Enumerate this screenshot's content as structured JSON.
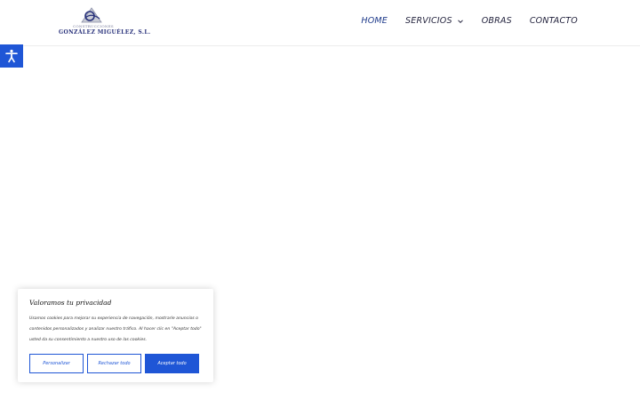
{
  "logo": {
    "small_text": "CONSTRUCCIONES",
    "main_text": "GONZÁLEZ MIGUÉLEZ, S.L."
  },
  "nav": {
    "home": "HOME",
    "servicios": "SERVICIOS",
    "obras": "OBRAS",
    "contacto": "CONTACTO"
  },
  "accessibility": {
    "icon": "accessibility-icon"
  },
  "cookie": {
    "title": "Valoramos tu privacidad",
    "text": "Usamos cookies para mejorar su experiencia de navegación, mostrarle anuncios o contenidos personalizados y analizar nuestro tráfico. Al hacer clic en \"Aceptar todo\" usted da su consentimiento a nuestro uso de las cookies.",
    "customize": "Personalizar",
    "reject": "Rechazar todo",
    "accept": "Aceptar todo"
  },
  "colors": {
    "accent": "#1f56d6",
    "nav_text": "#1f1f3a",
    "brand_navy": "#27307a"
  }
}
